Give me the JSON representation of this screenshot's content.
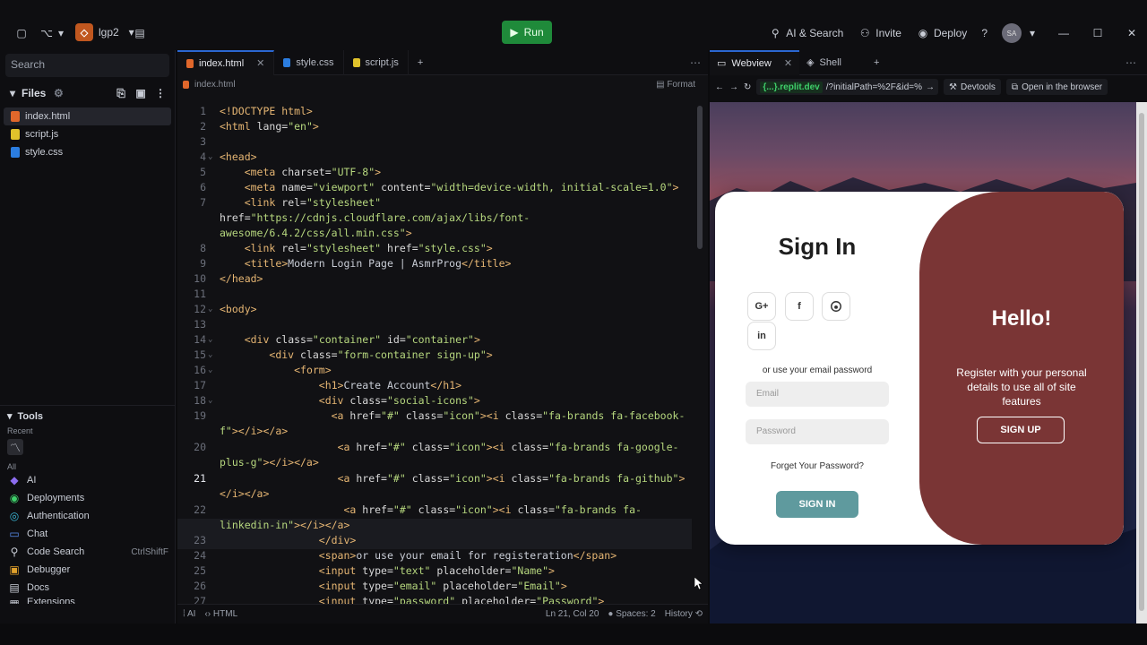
{
  "topbar": {
    "project": "lgp2",
    "run_label": "Run",
    "ai_search": "AI & Search",
    "invite": "Invite",
    "deploy": "Deploy",
    "help": "?",
    "avatar": "SA"
  },
  "sidebar": {
    "search_placeholder": "Search",
    "files_title": "Files",
    "files": [
      {
        "name": "index.html",
        "color": "#e0672b"
      },
      {
        "name": "script.js",
        "color": "#e0c22b"
      },
      {
        "name": "style.css",
        "color": "#2b7de0"
      }
    ],
    "tools_title": "Tools",
    "recent_label": "Recent",
    "all_label": "All",
    "tools": [
      {
        "name": "AI",
        "key": ""
      },
      {
        "name": "Deployments",
        "key": ""
      },
      {
        "name": "Authentication",
        "key": ""
      },
      {
        "name": "Chat",
        "key": ""
      },
      {
        "name": "Code Search",
        "key": "CtrlShiftF"
      },
      {
        "name": "Debugger",
        "key": ""
      },
      {
        "name": "Docs",
        "key": ""
      },
      {
        "name": "Extensions",
        "key": ""
      }
    ]
  },
  "editor": {
    "tabs": [
      "index.html",
      "style.css",
      "script.js"
    ],
    "breadcrumb": "index.html",
    "format_label": "Format",
    "status": {
      "ai": "AI",
      "lang": "HTML",
      "position": "Ln 21, Col 20",
      "spaces": "Spaces: 2",
      "history": "History"
    }
  },
  "webview": {
    "tabs": [
      "Webview",
      "Shell"
    ],
    "url_host": "{...}.replit.dev",
    "url_path": "/?initialPath=%2F&id=%",
    "devtools": "Devtools",
    "open_browser": "Open in the browser",
    "page": {
      "signin_title": "Sign In",
      "social": [
        "G+",
        "f",
        "gh",
        "in"
      ],
      "or_text": "or use your email password",
      "email_placeholder": "Email",
      "password_placeholder": "Password",
      "forgot": "Forget Your Password?",
      "signin_button": "SIGN IN",
      "hello": "Hello!",
      "register_text": "Register with your personal details to use all of site features",
      "signup_button": "SIGN UP"
    }
  }
}
